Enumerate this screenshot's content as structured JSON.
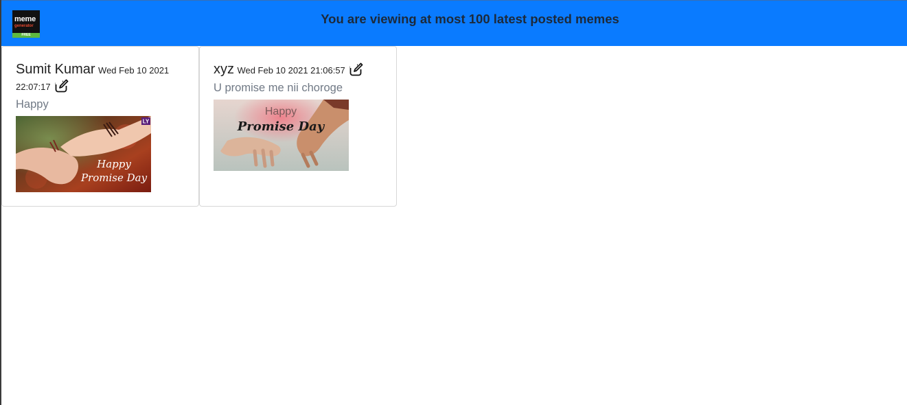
{
  "header": {
    "title": "You are viewing at most 100 latest posted memes",
    "logo": {
      "line1": "meme",
      "line2": "generator",
      "line3": "FREE"
    },
    "background_color": "#0a7bff"
  },
  "memes": [
    {
      "author": "Sumit Kumar",
      "date": "Wed Feb 10 2021 22:07:17",
      "caption": "Happy",
      "edit_icon": "edit-icon",
      "image": {
        "text_line1": "Happy",
        "text_line2": "Promise Day",
        "badge": "LY"
      }
    },
    {
      "author": "xyz",
      "date": "Wed Feb 10 2021 21:06:57",
      "caption": "U promise me nii choroge",
      "edit_icon": "edit-icon",
      "image": {
        "text_line1": "Happy",
        "text_line2": "Promise Day"
      }
    }
  ]
}
